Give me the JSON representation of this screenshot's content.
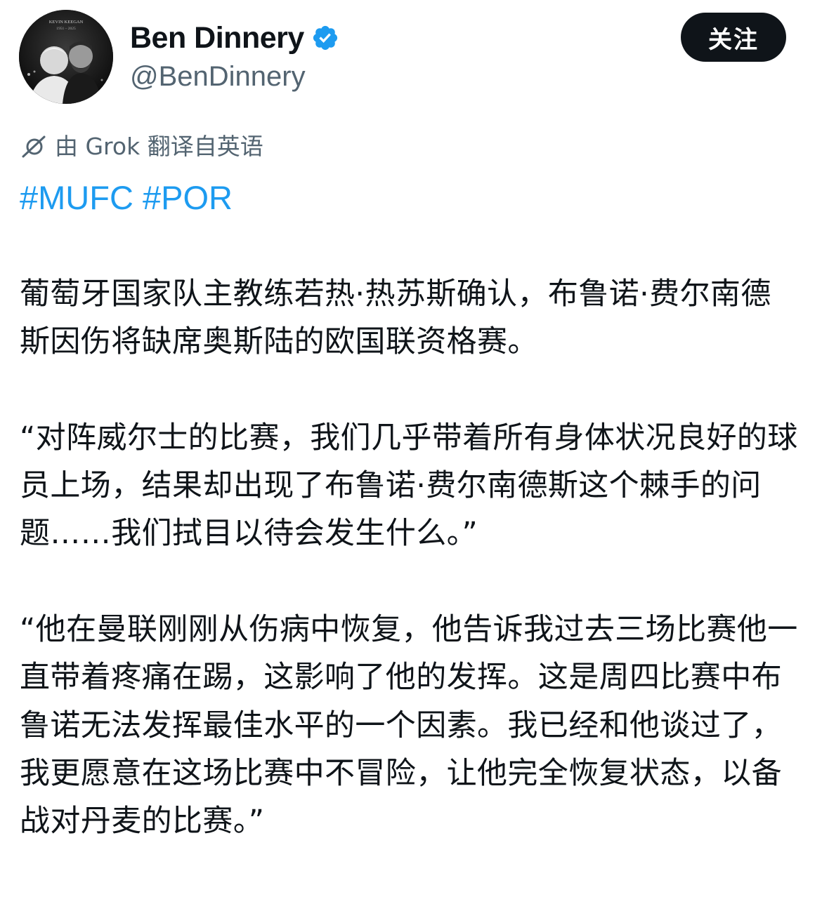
{
  "user": {
    "display_name": "Ben Dinnery",
    "handle": "@BenDinnery",
    "avatar_caption_name": "KEVIN KEEGAN",
    "avatar_caption_years": "1951 – 2025"
  },
  "follow_button": {
    "label": "关注"
  },
  "translation_note": {
    "text": "由 Grok 翻译自英语",
    "icon": "no-translate-icon"
  },
  "hashtags": [
    "#MUFC",
    "#POR"
  ],
  "paragraphs": [
    "葡萄牙国家队主教练若热·热苏斯确认，布鲁诺·费尔南德斯因伤将缺席奥斯陆的欧国联资格赛。",
    "“对阵威尔士的比赛，我们几乎带着所有身体状况良好的球员上场，结果却出现了布鲁诺·费尔南德斯这个棘手的问题……我们拭目以待会发生什么。”",
    "“他在曼联刚刚从伤病中恢复，他告诉我过去三场比赛他一直带着疼痛在踢，这影响了他的发挥。这是周四比赛中布鲁诺无法发挥最佳水平的一个因素。我已经和他谈过了，我更愿意在这场比赛中不冒险，让他完全恢复状态，以备战对丹麦的比赛。”"
  ],
  "colors": {
    "link": "#1d9bf0",
    "verified": "#1d9bf0",
    "secondary_text": "#536471",
    "button_bg": "#0f1419"
  }
}
